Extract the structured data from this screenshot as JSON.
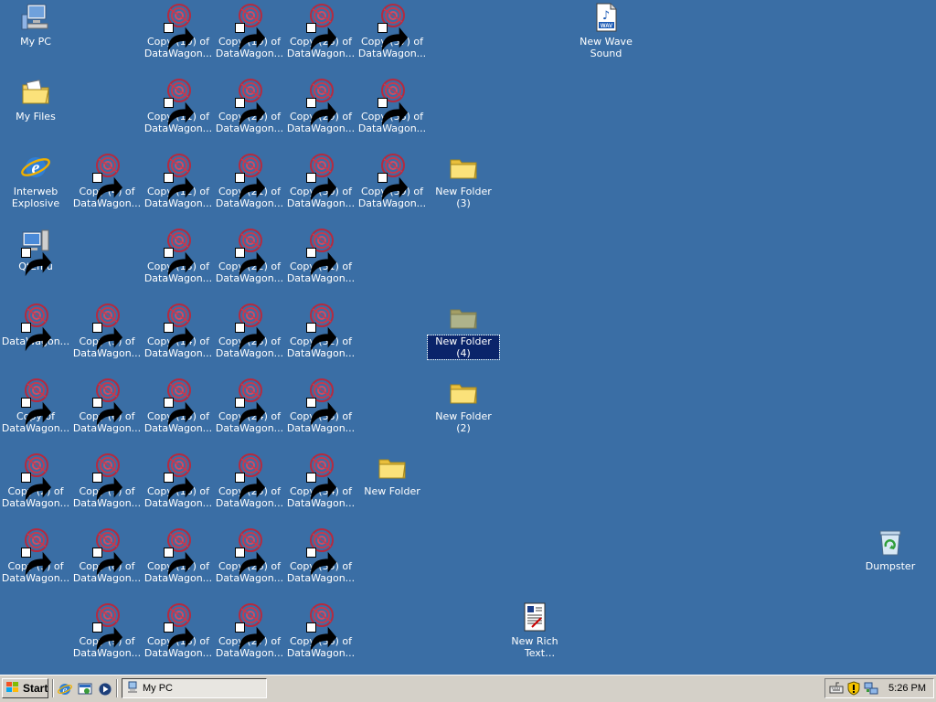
{
  "desktop": {
    "background_color": "#3a6ea5",
    "icons": [
      {
        "label": "My PC",
        "icon": "computer-icon",
        "shortcut": false,
        "selected": false
      },
      {
        "label": "My Files",
        "icon": "documents-folder-icon",
        "shortcut": false,
        "selected": false
      },
      {
        "label": "Interweb Explosive",
        "icon": "browser-icon",
        "shortcut": false,
        "selected": false
      },
      {
        "label": "QtEmu",
        "icon": "emulator-icon",
        "shortcut": true,
        "selected": false
      },
      {
        "label": "DataWagon...",
        "icon": "datawagon-icon",
        "shortcut": true,
        "selected": false
      },
      {
        "label": "Copy of DataWagon...",
        "icon": "datawagon-icon",
        "shortcut": true,
        "selected": false
      },
      {
        "label": "Copy (2) of DataWagon...",
        "icon": "datawagon-icon",
        "shortcut": true,
        "selected": false
      },
      {
        "label": "Copy (3) of DataWagon...",
        "icon": "datawagon-icon",
        "shortcut": true,
        "selected": false
      },
      {
        "label": "Copy (4) of DataWagon...",
        "icon": "datawagon-icon",
        "shortcut": true,
        "selected": false
      },
      {
        "label": "Copy (5) of DataWagon...",
        "icon": "datawagon-icon",
        "shortcut": true,
        "selected": false
      },
      {
        "label": "Copy (6) of DataWagon...",
        "icon": "datawagon-icon",
        "shortcut": true,
        "selected": false
      },
      {
        "label": "Copy (7) of DataWagon...",
        "icon": "datawagon-icon",
        "shortcut": true,
        "selected": false
      },
      {
        "label": "Copy (8) of DataWagon...",
        "icon": "datawagon-icon",
        "shortcut": true,
        "selected": false
      },
      {
        "label": "Copy (9) of DataWagon...",
        "icon": "datawagon-icon",
        "shortcut": true,
        "selected": false
      },
      {
        "label": "Copy (10) of DataWagon...",
        "icon": "datawagon-icon",
        "shortcut": true,
        "selected": false
      },
      {
        "label": "Copy (11) of DataWagon...",
        "icon": "datawagon-icon",
        "shortcut": true,
        "selected": false
      },
      {
        "label": "Copy (12) of DataWagon...",
        "icon": "datawagon-icon",
        "shortcut": true,
        "selected": false
      },
      {
        "label": "Copy (13) of DataWagon...",
        "icon": "datawagon-icon",
        "shortcut": true,
        "selected": false
      },
      {
        "label": "Copy (14) of DataWagon...",
        "icon": "datawagon-icon",
        "shortcut": true,
        "selected": false
      },
      {
        "label": "Copy (15) of DataWagon...",
        "icon": "datawagon-icon",
        "shortcut": true,
        "selected": false
      },
      {
        "label": "Copy (16) of DataWagon...",
        "icon": "datawagon-icon",
        "shortcut": true,
        "selected": false
      },
      {
        "label": "Copy (17) of DataWagon...",
        "icon": "datawagon-icon",
        "shortcut": true,
        "selected": false
      },
      {
        "label": "Copy (18) of DataWagon...",
        "icon": "datawagon-icon",
        "shortcut": true,
        "selected": false
      },
      {
        "label": "Copy (19) of DataWagon...",
        "icon": "datawagon-icon",
        "shortcut": true,
        "selected": false
      },
      {
        "label": "Copy (20) of DataWagon...",
        "icon": "datawagon-icon",
        "shortcut": true,
        "selected": false
      },
      {
        "label": "Copy (21) of DataWagon...",
        "icon": "datawagon-icon",
        "shortcut": true,
        "selected": false
      },
      {
        "label": "Copy (22) of DataWagon...",
        "icon": "datawagon-icon",
        "shortcut": true,
        "selected": false
      },
      {
        "label": "Copy (23) of DataWagon...",
        "icon": "datawagon-icon",
        "shortcut": true,
        "selected": false
      },
      {
        "label": "Copy (24) of DataWagon...",
        "icon": "datawagon-icon",
        "shortcut": true,
        "selected": false
      },
      {
        "label": "Copy (25) of DataWagon...",
        "icon": "datawagon-icon",
        "shortcut": true,
        "selected": false
      },
      {
        "label": "Copy (26) of DataWagon...",
        "icon": "datawagon-icon",
        "shortcut": true,
        "selected": false
      },
      {
        "label": "Copy (27) of DataWagon...",
        "icon": "datawagon-icon",
        "shortcut": true,
        "selected": false
      },
      {
        "label": "Copy (28) of DataWagon...",
        "icon": "datawagon-icon",
        "shortcut": true,
        "selected": false
      },
      {
        "label": "Copy (29) of DataWagon...",
        "icon": "datawagon-icon",
        "shortcut": true,
        "selected": false
      },
      {
        "label": "Copy (30) of DataWagon...",
        "icon": "datawagon-icon",
        "shortcut": true,
        "selected": false
      },
      {
        "label": "Copy (31) of DataWagon...",
        "icon": "datawagon-icon",
        "shortcut": true,
        "selected": false
      },
      {
        "label": "Copy (32) of DataWagon...",
        "icon": "datawagon-icon",
        "shortcut": true,
        "selected": false
      },
      {
        "label": "Copy (33) of DataWagon...",
        "icon": "datawagon-icon",
        "shortcut": true,
        "selected": false
      },
      {
        "label": "Copy (34) of DataWagon...",
        "icon": "datawagon-icon",
        "shortcut": true,
        "selected": false
      },
      {
        "label": "Copy (35) of DataWagon...",
        "icon": "datawagon-icon",
        "shortcut": true,
        "selected": false
      },
      {
        "label": "Copy (36) of DataWagon...",
        "icon": "datawagon-icon",
        "shortcut": true,
        "selected": false
      },
      {
        "label": "Copy (37) of DataWagon...",
        "icon": "datawagon-icon",
        "shortcut": true,
        "selected": false
      },
      {
        "label": "Copy (38) of DataWagon...",
        "icon": "datawagon-icon",
        "shortcut": true,
        "selected": false
      },
      {
        "label": "Copy (39) of DataWagon...",
        "icon": "datawagon-icon",
        "shortcut": true,
        "selected": false
      },
      {
        "label": "New Folder",
        "icon": "folder-icon",
        "shortcut": false,
        "selected": false
      },
      {
        "label": "New Folder (3)",
        "icon": "folder-icon",
        "shortcut": false,
        "selected": false
      },
      {
        "label": "New Folder (4)",
        "icon": "folder-icon",
        "shortcut": false,
        "selected": true
      },
      {
        "label": "New Folder (2)",
        "icon": "folder-icon",
        "shortcut": false,
        "selected": false
      },
      {
        "label": "New Rich Text Document",
        "icon": "rich-text-document-icon",
        "shortcut": false,
        "selected": false
      },
      {
        "label": "New Wave Sound",
        "icon": "wave-sound-file-icon",
        "shortcut": false,
        "selected": false
      },
      {
        "label": "Dumpster",
        "icon": "recycle-bin-icon",
        "shortcut": false,
        "selected": false
      }
    ]
  },
  "taskbar": {
    "start_label": "Start",
    "quick_launch": [
      {
        "icon": "browser-icon"
      },
      {
        "icon": "show-desktop-icon"
      },
      {
        "icon": "media-player-icon"
      }
    ],
    "tasks": [
      {
        "label": "My PC",
        "icon": "computer-icon",
        "active": true
      }
    ],
    "tray": {
      "icons": [
        "keyboard-icon",
        "security-shield-icon",
        "network-icon"
      ],
      "clock": "5:26 PM"
    }
  }
}
